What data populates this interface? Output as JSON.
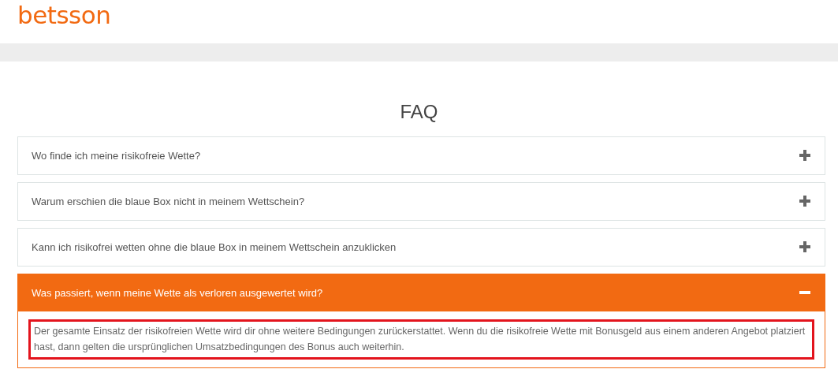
{
  "header": {
    "logo": "betsson"
  },
  "title": "FAQ",
  "faq": [
    {
      "question": "Wo finde ich meine risikofreie Wette?",
      "expanded": false
    },
    {
      "question": "Warum erschien die blaue Box nicht in meinem Wettschein?",
      "expanded": false
    },
    {
      "question": "Kann ich risikofrei wetten ohne die blaue Box in meinem Wettschein anzuklicken",
      "expanded": false
    },
    {
      "question": "Was passiert, wenn meine Wette als verloren ausgewertet wird?",
      "expanded": true,
      "answer": "Der gesamte Einsatz der risikofreien Wette wird dir ohne weitere Bedingungen zurückerstattet. Wenn du die risikofreie Wette mit Bonusgeld aus einem anderen Angebot platziert hast, dann gelten die ursprünglichen Umsatzbedingungen des Bonus auch weiterhin.",
      "highlighted": true
    }
  ]
}
